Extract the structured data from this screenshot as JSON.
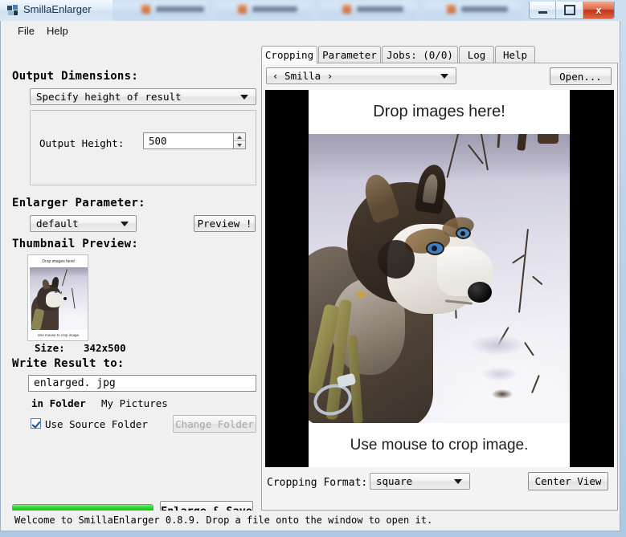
{
  "window": {
    "title": "SmillaEnlarger",
    "app_icon": "app-icon",
    "minimize_label": "",
    "maximize_label": "",
    "close_label": "x"
  },
  "menu": {
    "items": [
      "File",
      "Help"
    ]
  },
  "left": {
    "output_dimensions_heading": "Output Dimensions:",
    "mode_combo_value": "Specify height of result",
    "output_height_label": "Output Height:",
    "output_height_value": "500",
    "enlarger_parameter_heading": "Enlarger Parameter:",
    "parameter_combo_value": "default",
    "preview_button": "Preview !",
    "thumbnail_heading": "Thumbnail Preview:",
    "size_label": "Size:",
    "size_value": "342x500",
    "write_result_heading": "Write Result to:",
    "filename_value": "enlarged. jpg",
    "in_folder_label": "in Folder",
    "folder_value": "My Pictures",
    "use_source_folder_label": "Use Source Folder",
    "use_source_folder_checked": true,
    "change_folder_button": "Change Folder",
    "enlarge_save_button": "Enlarge & Save",
    "progress_percent": 100
  },
  "right": {
    "tabs": [
      {
        "label": "Cropping",
        "active": true
      },
      {
        "label": "Parameter",
        "active": false
      },
      {
        "label": "Jobs: (0/0)",
        "active": false
      },
      {
        "label": "Log",
        "active": false
      },
      {
        "label": "Help",
        "active": false
      }
    ],
    "file_combo_value": "‹ Smilla ›",
    "open_button": "Open...",
    "drop_hint_top": "Drop images here!",
    "drop_hint_bottom": "Use mouse to crop image.",
    "cropping_format_label": "Cropping Format:",
    "cropping_format_value": "square",
    "center_view_button": "Center View"
  },
  "statusbar": {
    "text": "Welcome to SmillaEnlarger 0.8.9.  Drop a file onto the window to open it."
  },
  "colors": {
    "progress_green": "#00bf00",
    "titlebar_close_red": "#c2341a",
    "panel_bg": "#f0f0f0"
  }
}
